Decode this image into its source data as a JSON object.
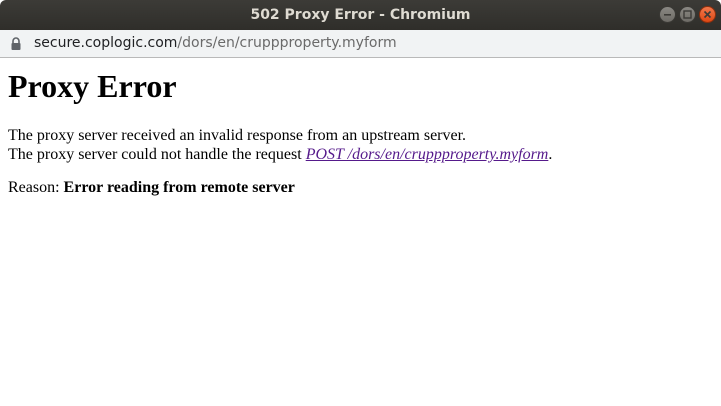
{
  "window": {
    "title": "502 Proxy Error - Chromium"
  },
  "addressbar": {
    "host": "secure.coplogic.com",
    "path": "/dors/en/cruppproperty.myform"
  },
  "page": {
    "heading": "Proxy Error",
    "line1": "The proxy server received an invalid response from an upstream server.",
    "line2_prefix": "The proxy server could not handle the request ",
    "line2_link": "POST /dors/en/cruppproperty.myform",
    "line2_suffix": ".",
    "reason_label": "Reason: ",
    "reason_value": "Error reading from remote server"
  },
  "icons": {
    "lock": "lock-icon",
    "minimize": "minimize-icon",
    "maximize": "maximize-icon",
    "close": "close-icon"
  },
  "colors": {
    "titlebar": "#3c3b37",
    "close_button": "#dd4814",
    "visited_link": "#551a8b"
  }
}
